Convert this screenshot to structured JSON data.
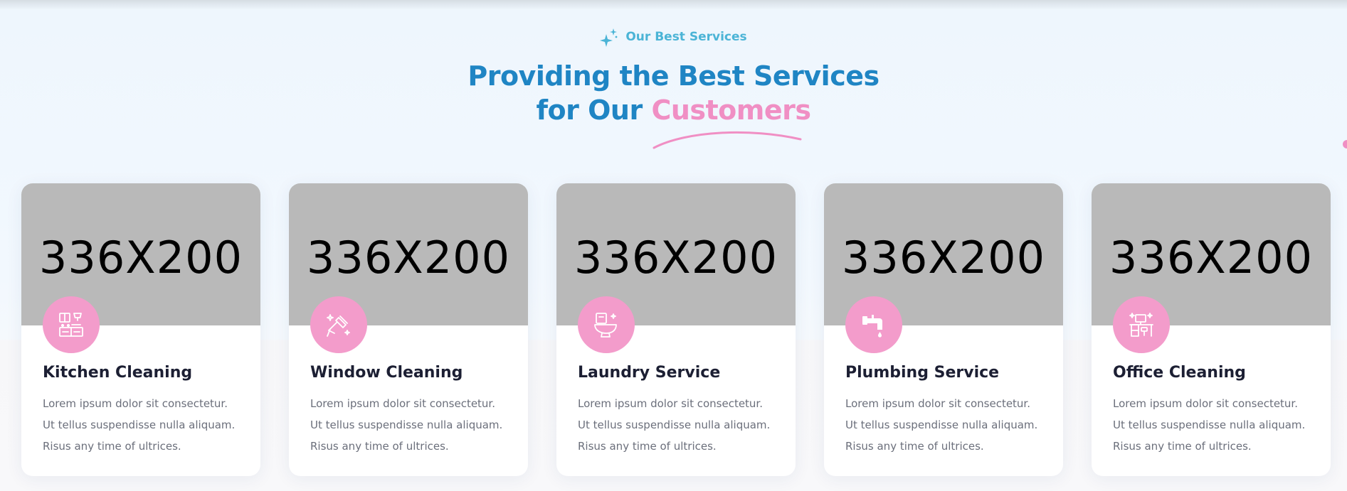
{
  "header": {
    "eyebrow": "Our Best Services",
    "headline_line1": "Providing the Best Services",
    "headline_line2_prefix": "for Our ",
    "headline_line2_accent": "Customers"
  },
  "colors": {
    "brand_blue": "#1f85c4",
    "accent_pink": "#f08fc4",
    "eyebrow_cyan": "#4bb4d6",
    "icon_circle": "#f39ccb",
    "placeholder_gray": "#b9b9b9"
  },
  "services": [
    {
      "image_placeholder": "336X200",
      "icon": "kitchen-icon",
      "title": "Kitchen Cleaning",
      "desc": [
        "Lorem ipsum dolor sit consectetur.",
        "Ut tellus suspendisse nulla aliquam.",
        "Risus any time of ultrices."
      ]
    },
    {
      "image_placeholder": "336X200",
      "icon": "window-cleaning-icon",
      "title": "Window Cleaning",
      "desc": [
        "Lorem ipsum dolor sit consectetur.",
        "Ut tellus suspendisse nulla aliquam.",
        "Risus any time of ultrices."
      ]
    },
    {
      "image_placeholder": "336X200",
      "icon": "toilet-icon",
      "title": "Laundry Service",
      "desc": [
        "Lorem ipsum dolor sit consectetur.",
        "Ut tellus suspendisse nulla aliquam.",
        "Risus any time of ultrices."
      ]
    },
    {
      "image_placeholder": "336X200",
      "icon": "faucet-icon",
      "title": "Plumbing Service",
      "desc": [
        "Lorem ipsum dolor sit consectetur.",
        "Ut tellus suspendisse nulla aliquam.",
        "Risus any time of ultrices."
      ]
    },
    {
      "image_placeholder": "336X200",
      "icon": "office-desk-icon",
      "title": "Office Cleaning",
      "desc": [
        "Lorem ipsum dolor sit consectetur.",
        "Ut tellus suspendisse nulla aliquam.",
        "Risus any time of ultrices."
      ]
    }
  ]
}
